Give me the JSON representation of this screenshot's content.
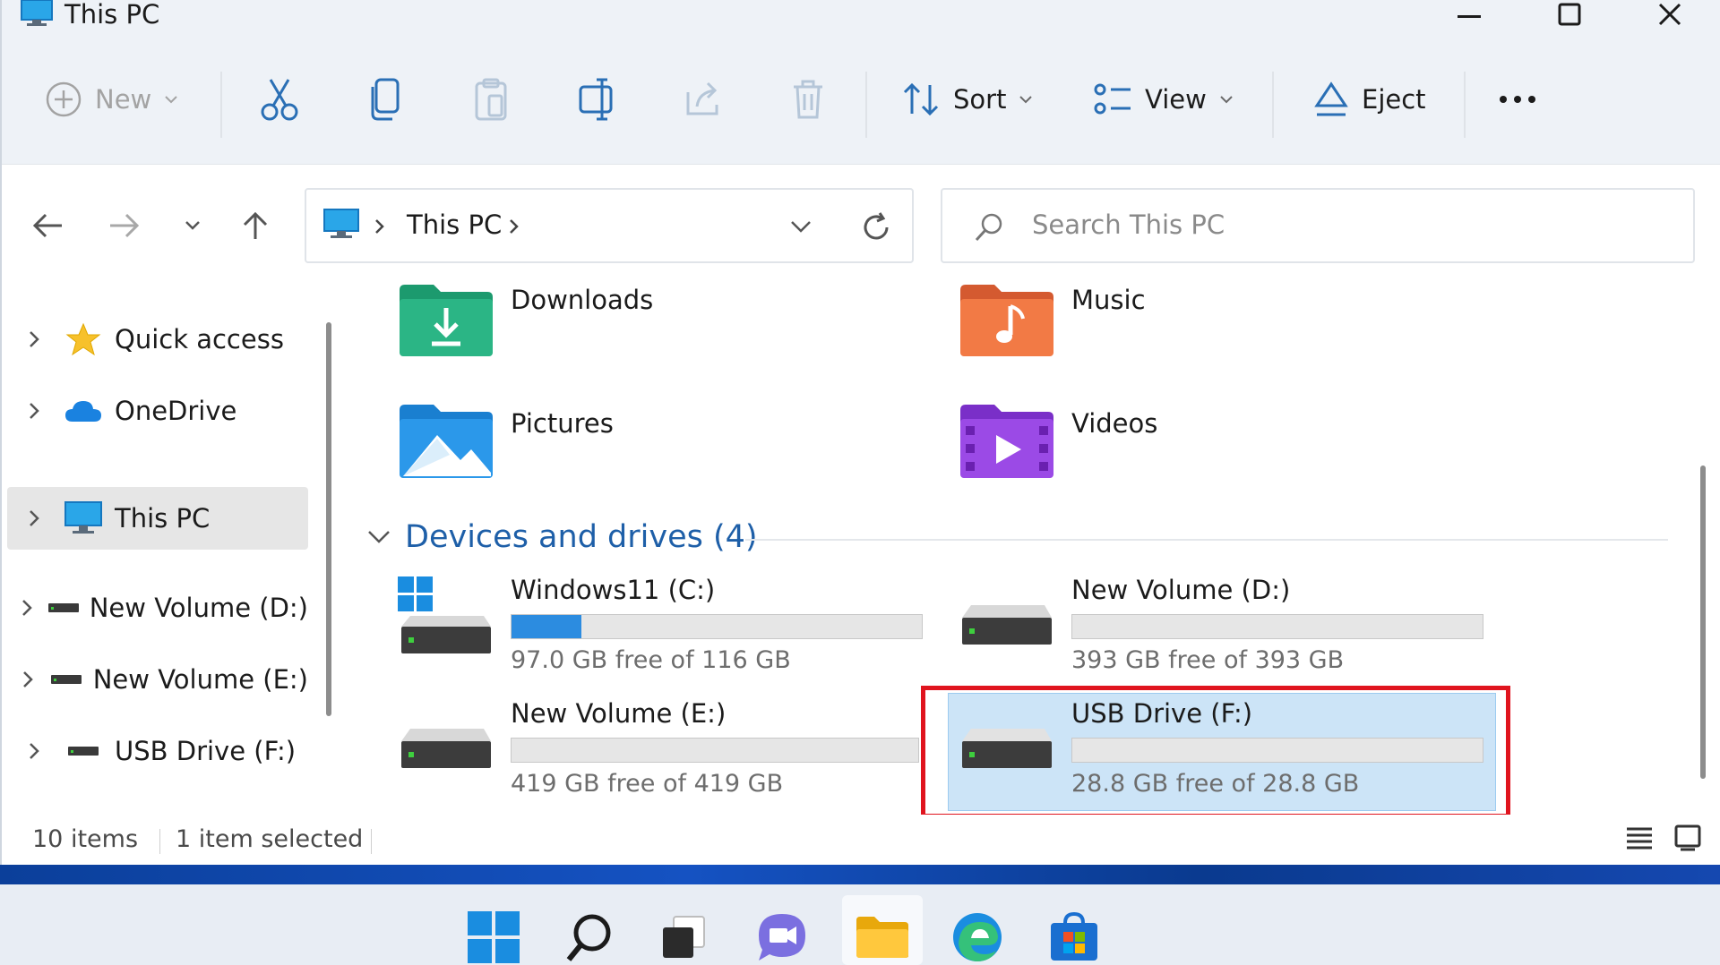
{
  "window": {
    "title": "This PC"
  },
  "toolbar": {
    "new_label": "New",
    "sort_label": "Sort",
    "view_label": "View",
    "eject_label": "Eject"
  },
  "address": {
    "path": "This PC"
  },
  "search": {
    "placeholder": "Search This PC"
  },
  "sidebar": {
    "items": [
      {
        "label": "Quick access",
        "icon": "star-icon"
      },
      {
        "label": "OneDrive",
        "icon": "cloud-icon"
      },
      {
        "label": "This PC",
        "icon": "monitor-icon",
        "selected": true
      },
      {
        "label": "New Volume (D:)",
        "icon": "drive-icon"
      },
      {
        "label": "New Volume (E:)",
        "icon": "drive-icon"
      },
      {
        "label": "USB Drive (F:)",
        "icon": "drive-icon"
      }
    ]
  },
  "folders": [
    {
      "label": "Downloads",
      "icon": "downloads-folder-icon"
    },
    {
      "label": "Music",
      "icon": "music-folder-icon"
    },
    {
      "label": "Pictures",
      "icon": "pictures-folder-icon"
    },
    {
      "label": "Videos",
      "icon": "videos-folder-icon"
    }
  ],
  "devices": {
    "heading": "Devices and drives (4)",
    "drives": [
      {
        "name": "Windows11 (C:)",
        "free_text": "97.0 GB free of 116 GB",
        "used_fraction": 0.17
      },
      {
        "name": "New Volume (D:)",
        "free_text": "393 GB free of 393 GB",
        "used_fraction": 0
      },
      {
        "name": "New Volume (E:)",
        "free_text": "419 GB free of 419 GB",
        "used_fraction": 0
      },
      {
        "name": "USB Drive (F:)",
        "free_text": "28.8 GB free of 28.8 GB",
        "used_fraction": 0,
        "selected": true
      }
    ]
  },
  "status": {
    "items_count": "10 items",
    "selection": "1 item selected"
  },
  "colors": {
    "accent": "#2c8ce0",
    "highlight_box": "#e0141e",
    "selection_bg": "#cce4f7"
  }
}
